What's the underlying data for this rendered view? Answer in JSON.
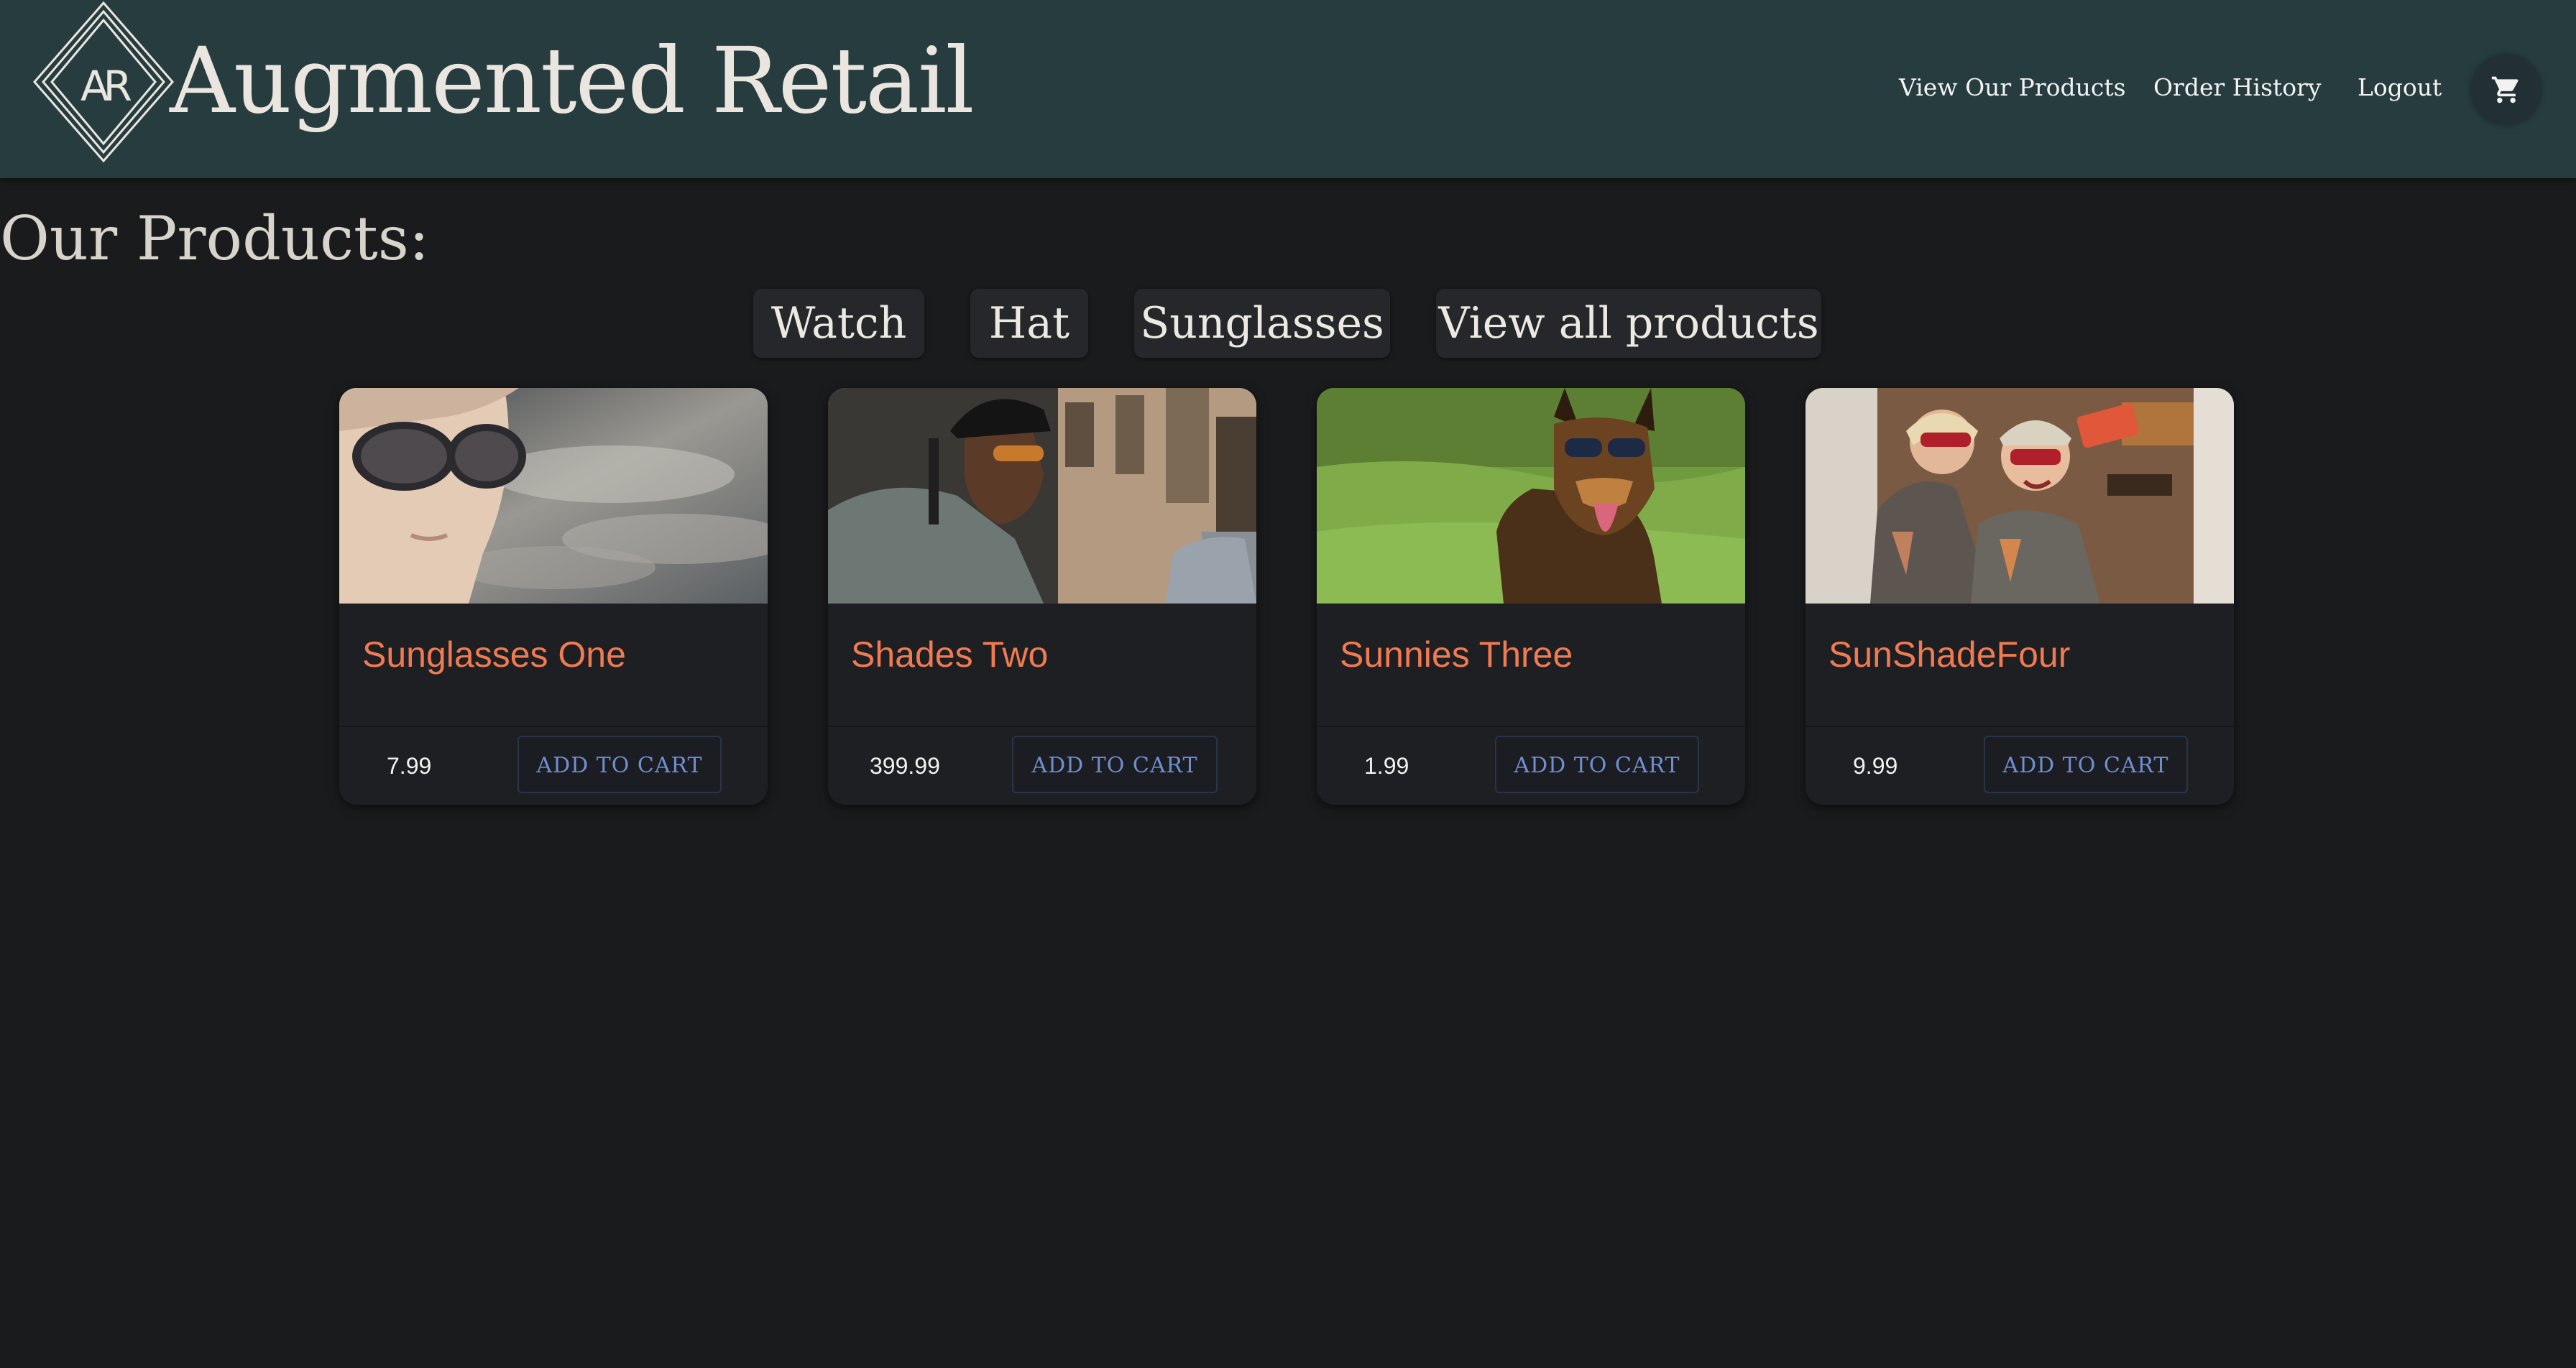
{
  "header": {
    "logo_letters": "AR",
    "brand": "Augmented Retail",
    "nav": {
      "products": "View Our Products",
      "orders": "Order History",
      "logout": "Logout"
    },
    "cart_icon": "shopping-cart-icon"
  },
  "page": {
    "title": "Our Products:"
  },
  "filters": [
    "Watch",
    "Hat",
    "Sunglasses",
    "View all products"
  ],
  "products": [
    {
      "name": "Sunglasses One",
      "price": "7.99",
      "button": "ADD TO CART"
    },
    {
      "name": "Shades Two",
      "price": "399.99",
      "button": "ADD TO CART"
    },
    {
      "name": "Sunnies Three",
      "price": "1.99",
      "button": "ADD TO CART"
    },
    {
      "name": "SunShadeFour",
      "price": "9.99",
      "button": "ADD TO CART"
    }
  ],
  "colors": {
    "header_bg": "#263c3f",
    "page_bg": "#1a1b1d",
    "product_title": "#f07a52",
    "button_text": "#6f8fd0"
  }
}
